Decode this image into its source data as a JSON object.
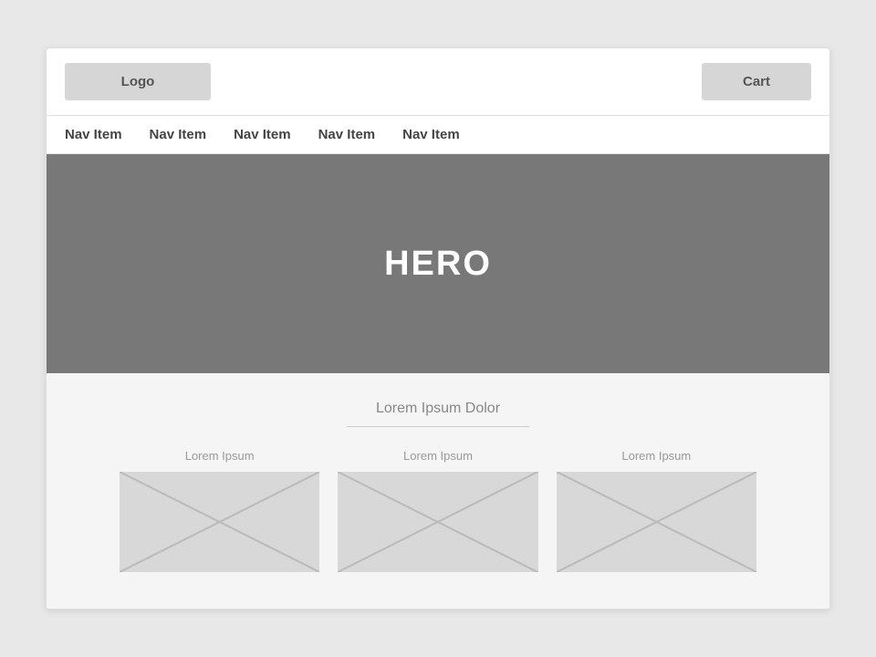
{
  "header": {
    "logo_label": "Logo",
    "cart_label": "Cart"
  },
  "navbar": {
    "items": [
      {
        "label": "Nav Item"
      },
      {
        "label": "Nav Item"
      },
      {
        "label": "Nav Item"
      },
      {
        "label": "Nav Item"
      },
      {
        "label": "Nav Item"
      }
    ]
  },
  "hero": {
    "title": "HERO"
  },
  "content": {
    "section_title": "Lorem Ipsum Dolor",
    "columns": [
      {
        "label": "Lorem Ipsum"
      },
      {
        "label": "Lorem Ipsum"
      },
      {
        "label": "Lorem Ipsum"
      }
    ]
  }
}
